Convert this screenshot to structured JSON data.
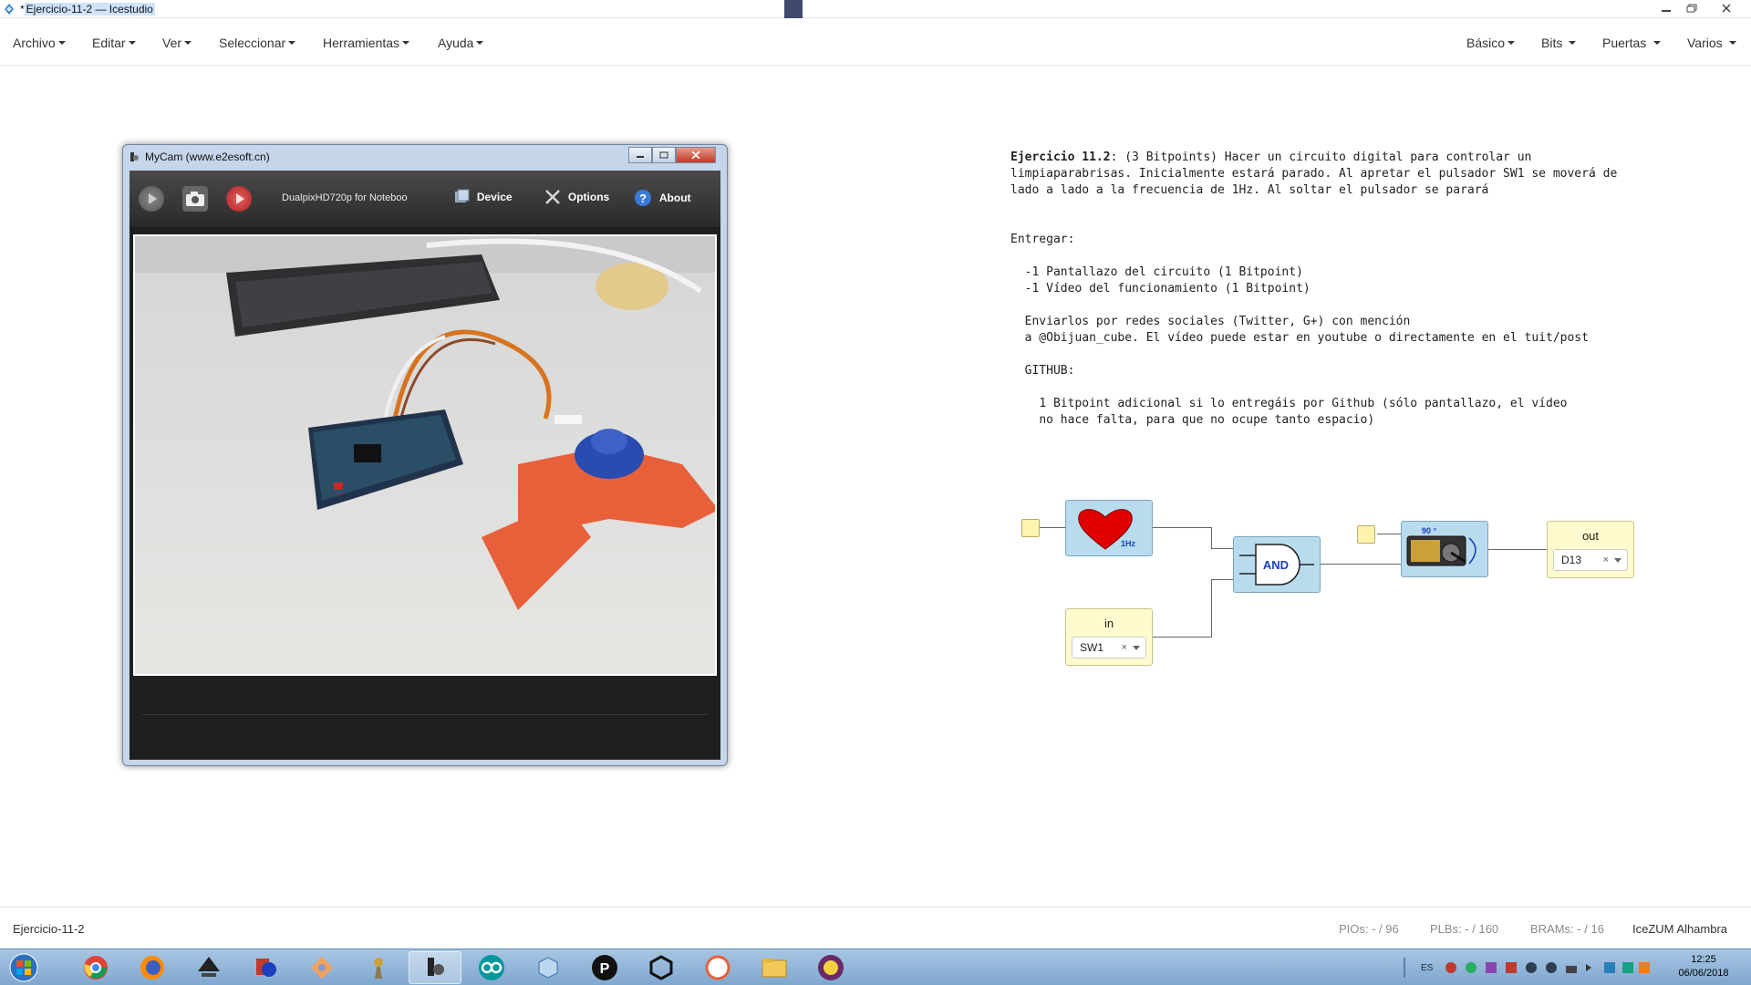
{
  "window": {
    "title_prefix": "*",
    "title_highlight": "Ejercicio-11-2 — Icestudio",
    "controls": {
      "minimize": "minimize",
      "restore": "restore",
      "close": "close"
    }
  },
  "menubar": {
    "left": [
      "Archivo",
      "Editar",
      "Ver",
      "Seleccionar",
      "Herramientas",
      "Ayuda"
    ],
    "right": [
      "Básico",
      "Bits",
      "Puertas",
      "Varios"
    ]
  },
  "mycam": {
    "title": "MyCam (www.e2esoft.cn)",
    "device_name": "DualpixHD720p for Noteboo",
    "device_label": "Device",
    "options_label": "Options",
    "about_label": "About",
    "icons": [
      "play-icon",
      "camera-icon",
      "record-icon",
      "device-icon",
      "options-icon",
      "about-icon"
    ]
  },
  "exercise": {
    "title_bold": "Ejercicio 11.2",
    "line1": ": (3 Bitpoints) Hacer un circuito digital para controlar un",
    "line2": "limpiaparabrisas. Inicialmente estará parado. Al apretar el pulsador SW1 se moverá de",
    "line3": "lado a lado a la frecuencia de 1Hz. Al soltar el pulsador se parará",
    "entregar": "Entregar:",
    "item1": "  -1 Pantallazo del circuito (1 Bitpoint)",
    "item2": "  -1 Vídeo del funcionamiento (1 Bitpoint)",
    "send1": "  Enviarlos por redes sociales (Twitter, G+) con mención",
    "send2": "  a @Obijuan_cube. El vídeo puede estar en youtube o directamente en el tuit/post",
    "github": "  GITHUB:",
    "gh1": "    1 Bitpoint adicional si lo entregáis por Github (sólo pantallazo, el vídeo",
    "gh2": "    no hace falta, para que no ocupe tanto espacio)"
  },
  "circuit": {
    "heart_label": "1Hz",
    "and_label": "AND",
    "servo_angle": "90 °",
    "in_block": {
      "label": "in",
      "value": "SW1",
      "clear": "×"
    },
    "out_block": {
      "label": "out",
      "value": "D13",
      "clear": "×"
    },
    "colors": {
      "block_blue": "#b8dcee",
      "io_yellow": "#fffbcf",
      "heart_red": "#e00000",
      "and_text": "#1a3fbf"
    }
  },
  "statusbar": {
    "project": "Ejercicio-11-2",
    "pios": "PIOs: - / 96",
    "plbs": "PLBs: - / 160",
    "brams": "BRAMs: - / 16",
    "board": "IceZUM Alhambra"
  },
  "taskbar": {
    "apps": [
      "start-orb",
      "chrome-icon",
      "firefox-icon",
      "inkscape-icon",
      "settings-app-icon",
      "git-icon",
      "freecad-icon",
      "mycam-icon",
      "arduino-icon",
      "slicer-icon",
      "processing-icon",
      "unity-icon",
      "app-a-icon",
      "file-explorer-icon",
      "pro-app-icon"
    ],
    "lang": "ES",
    "time": "12:25",
    "date": "06/06/2018"
  }
}
